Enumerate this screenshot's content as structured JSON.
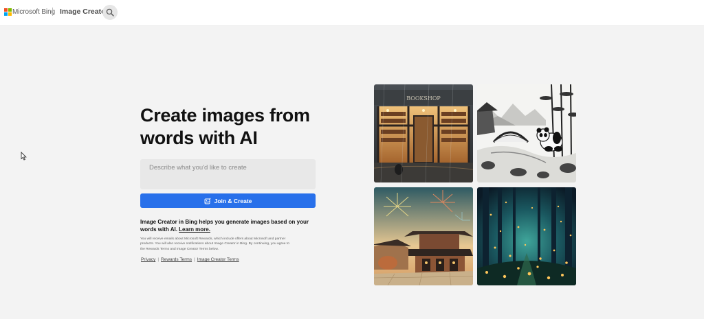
{
  "header": {
    "brand": "Microsoft Bing",
    "product": "Image Creator",
    "logo_colors": [
      "#f25022",
      "#7fba00",
      "#00a4ef",
      "#ffb900"
    ],
    "search_icon": "search-icon"
  },
  "hero": {
    "title": "Create images from words with AI",
    "prompt_placeholder": "Describe what you'd like to create",
    "create_button": "Join & Create",
    "create_icon": "image-sparkle-icon",
    "accent_color": "#2870ea",
    "description": "Image Creator in Bing helps you generate images based on your words with AI.",
    "learn_more": "Learn more.",
    "fine_print": "You will receive emails about Microsoft Rewards, which include offers about Microsoft and partner products. You will also receive notifications about Image Creator in Bing. By continuing, you agree to the Rewards Terms and Image Creator Terms below.",
    "links": [
      "Privacy",
      "Rewards Terms",
      "Image Creator Terms"
    ],
    "link_separator": "|"
  },
  "gallery": {
    "bookshop_sign": "BOOKSHOP"
  }
}
